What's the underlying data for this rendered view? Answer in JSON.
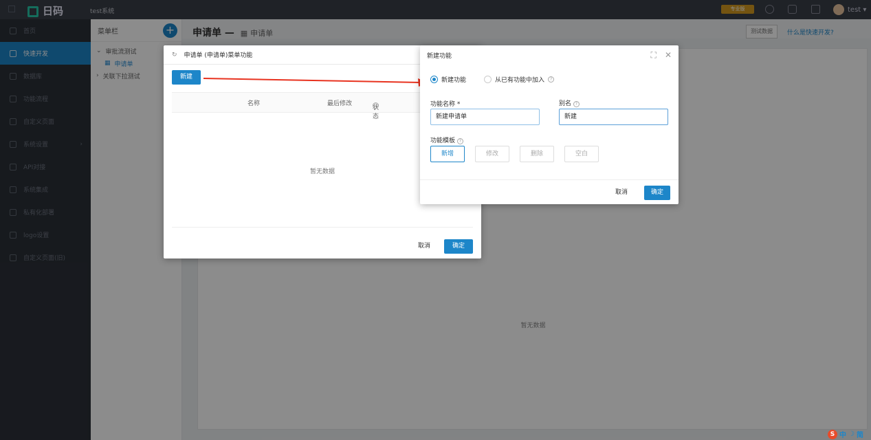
{
  "topbar": {
    "logo": "日码",
    "system": "test系统",
    "badge": "专业版",
    "user": "test ▾"
  },
  "sidebar": {
    "items": [
      {
        "label": "首页",
        "active": false
      },
      {
        "label": "快速开发",
        "active": true
      },
      {
        "label": "数据库",
        "active": false
      },
      {
        "label": "功能流程",
        "active": false
      },
      {
        "label": "自定义页面",
        "active": false
      },
      {
        "label": "系统设置",
        "active": false
      },
      {
        "label": "API对接",
        "active": false
      },
      {
        "label": "系统集成",
        "active": false
      },
      {
        "label": "私有化部署",
        "active": false
      },
      {
        "label": "logo设置",
        "active": false
      },
      {
        "label": "自定义页面(旧)",
        "active": false
      }
    ]
  },
  "menu": {
    "head": "菜单栏",
    "items": [
      "审批流测试",
      "申请单",
      "关联下拉测试"
    ]
  },
  "main": {
    "title": "申请单",
    "subtitle": "申请单",
    "test_data": "测试数据",
    "help_link": "什么是快速开发?",
    "empty": "暂无数据"
  },
  "dialog1": {
    "title": "申请单 (申请单)菜单功能",
    "new_btn": "新建",
    "columns": [
      "名称",
      "最后修改",
      "状态"
    ],
    "empty": "暂无数据",
    "cancel": "取消",
    "ok": "确定"
  },
  "dialog2": {
    "title": "新建功能",
    "radio_new": "新建功能",
    "radio_existing": "从已有功能中加入",
    "name_label": "功能名称 *",
    "name_value": "新建申请单",
    "alias_label": "别名",
    "alias_value": "新建",
    "template_label": "功能模板",
    "templates": [
      "新增",
      "修改",
      "删除",
      "空白"
    ],
    "cancel": "取消",
    "ok": "确定"
  },
  "ime": {
    "label": "中",
    "mode": "简"
  }
}
